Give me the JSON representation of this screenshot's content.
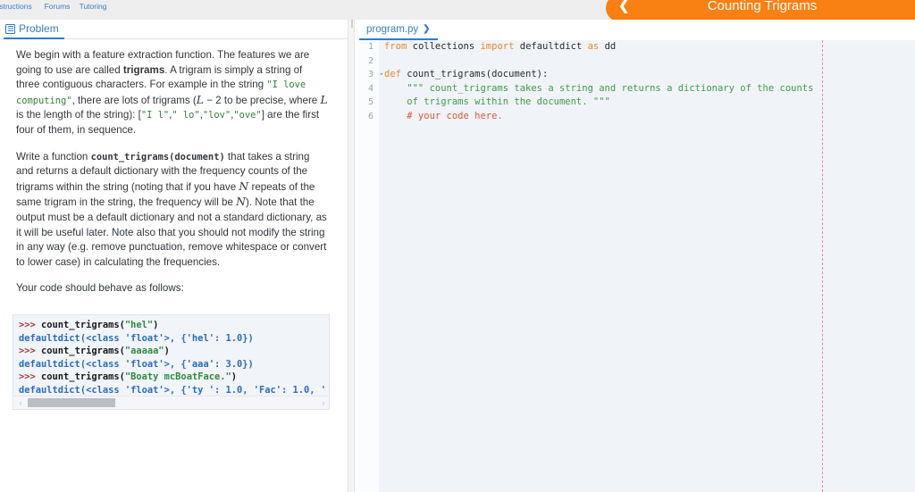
{
  "topnav": {
    "items": [
      {
        "label": "Instructions",
        "icon": "info-circle-icon",
        "glyph": "ⓘ"
      },
      {
        "label": "Forums",
        "icon": "forum-speech-icon",
        "glyph": "🗩"
      },
      {
        "label": "Tutoring",
        "icon": "tutoring-chat-icon",
        "glyph": "💬"
      }
    ]
  },
  "banner": {
    "title": "Counting Trigrams",
    "back_glyph": "❮",
    "color": "#f98012"
  },
  "left_panel": {
    "tab": {
      "label": "Problem",
      "icon": "document-list-icon"
    },
    "paragraph1": {
      "seg1": "We begin with a feature extraction function. The features we are going to use are called ",
      "bold1": "trigrams",
      "seg2": ". A trigram is simply a string of three contiguous characters. For example in the string ",
      "code1": "\"I love computing\"",
      "seg3": ", there are lots of trigrams (",
      "math1": "L",
      "seg4": " − 2 to be precise, where ",
      "math2": "L",
      "seg5": " is the length of the string): [",
      "code2": "\"I l\"",
      "seg6": ",",
      "code3": "\" lo\"",
      "seg7": ",",
      "code4": "\"lov\"",
      "seg8": ",",
      "code5": "\"ove\"",
      "seg9": "] are the first four of them, in sequence."
    },
    "paragraph2": {
      "seg1": "Write a function ",
      "code1": "count_trigrams(document)",
      "seg2": " that takes a string and returns a default dictionary with the frequency counts of the trigrams within the string (noting that if you have ",
      "math1": "N",
      "seg3": " repeats of the same trigram in the string, the frequency will be ",
      "math2": "N",
      "seg4": "). Note that the output must be a default dictionary and not a standard dictionary, as it will be useful later. Note also that you should not modify the string in any way (e.g. remove punctuation, remove whitespace or convert to lower case) in calculating the frequencies."
    },
    "paragraph3": "Your code should behave as follows:",
    "example_block": {
      "lines": [
        {
          "type": "prompt",
          "prompt": ">>> ",
          "call": "count_trigrams(",
          "string": "\"hel\"",
          "tail": ")"
        },
        {
          "type": "output",
          "text": "defaultdict(<class 'float'>, {'hel': 1.0})"
        },
        {
          "type": "prompt",
          "prompt": ">>> ",
          "call": "count_trigrams(",
          "string": "\"aaaaa\"",
          "tail": ")"
        },
        {
          "type": "output",
          "text": "defaultdict(<class 'float'>, {'aaa': 3.0})"
        },
        {
          "type": "prompt",
          "prompt": ">>> ",
          "call": "count_trigrams(",
          "string": "\"Boaty mcBoatFace.\"",
          "tail": ")"
        },
        {
          "type": "output",
          "text": "defaultdict(<class 'float'>, {'ty ': 1.0, 'Fac': 1.0, '"
        }
      ],
      "scroll_left_glyph": "‹",
      "scroll_right_glyph": "›"
    }
  },
  "right_panel": {
    "tab": {
      "label": "program.py",
      "chevron": "❯"
    },
    "editor": {
      "gutter": [
        {
          "num": "1",
          "fold": ""
        },
        {
          "num": "2",
          "fold": ""
        },
        {
          "num": "3",
          "fold": "▾"
        },
        {
          "num": "4",
          "fold": ""
        },
        {
          "num": "5",
          "fold": ""
        },
        {
          "num": "6",
          "fold": ""
        }
      ],
      "lines": [
        [
          {
            "t": "kw",
            "s": "from"
          },
          {
            "t": "plain",
            "s": " collections "
          },
          {
            "t": "kw",
            "s": "import"
          },
          {
            "t": "plain",
            "s": " defaultdict "
          },
          {
            "t": "kw",
            "s": "as"
          },
          {
            "t": "plain",
            "s": " dd"
          }
        ],
        [],
        [
          {
            "t": "kw",
            "s": "def"
          },
          {
            "t": "plain",
            "s": " count_trigrams(document):"
          }
        ],
        [
          {
            "t": "str",
            "s": "    \"\"\" count_trigrams takes a string and returns a dictionary of the counts"
          }
        ],
        [
          {
            "t": "str",
            "s": "    of trigrams within the document. \"\"\""
          }
        ],
        [
          {
            "t": "cmt",
            "s": "    # your code here."
          }
        ]
      ]
    }
  }
}
